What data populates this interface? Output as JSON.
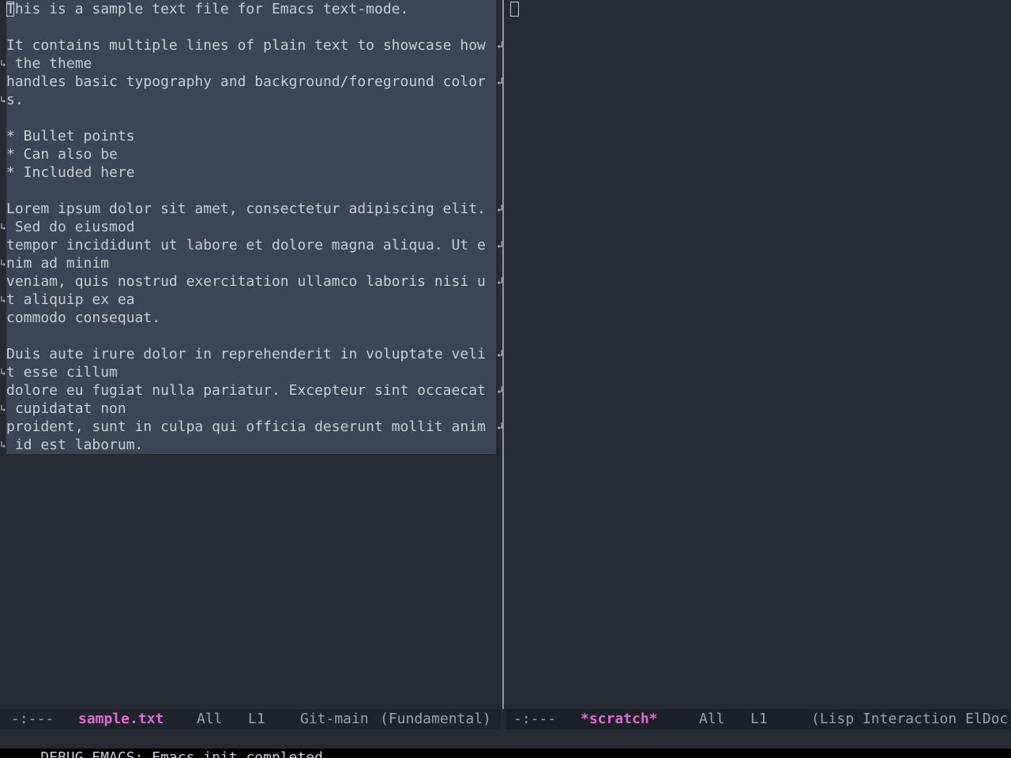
{
  "left_window": {
    "lines": [
      {
        "text": "This is a sample text file for Emacs text-mode."
      },
      {
        "text": ""
      },
      {
        "text": "It contains multiple lines of plain text to showcase how",
        "wrap_right": true
      },
      {
        "text": " the theme",
        "wrap_left": true
      },
      {
        "text": "handles basic typography and background/foreground color",
        "wrap_right": true
      },
      {
        "text": "s.",
        "wrap_left": true
      },
      {
        "text": ""
      },
      {
        "text": "* Bullet points"
      },
      {
        "text": "* Can also be"
      },
      {
        "text": "* Included here"
      },
      {
        "text": ""
      },
      {
        "text": "Lorem ipsum dolor sit amet, consectetur adipiscing elit.",
        "wrap_right": true
      },
      {
        "text": " Sed do eiusmod",
        "wrap_left": true
      },
      {
        "text": "tempor incididunt ut labore et dolore magna aliqua. Ut e",
        "wrap_right": true
      },
      {
        "text": "nim ad minim",
        "wrap_left": true
      },
      {
        "text": "veniam, quis nostrud exercitation ullamco laboris nisi u",
        "wrap_right": true
      },
      {
        "text": "t aliquip ex ea",
        "wrap_left": true
      },
      {
        "text": "commodo consequat."
      },
      {
        "text": ""
      },
      {
        "text": "Duis aute irure dolor in reprehenderit in voluptate veli",
        "wrap_right": true
      },
      {
        "text": "t esse cillum",
        "wrap_left": true
      },
      {
        "text": "dolore eu fugiat nulla pariatur. Excepteur sint occaecat",
        "wrap_right": true
      },
      {
        "text": " cupidatat non",
        "wrap_left": true
      },
      {
        "text": "proident, sunt in culpa qui officia deserunt mollit anim",
        "wrap_right": true
      },
      {
        "text": " id est laborum.",
        "wrap_left": true
      }
    ]
  },
  "left_modeline": {
    "status": "-:---",
    "buffer": "sample.txt",
    "position": "All",
    "line": "L1",
    "vc": "Git-main",
    "mode": "(Fundamental)"
  },
  "right_modeline": {
    "status": "-:---",
    "buffer": "*scratch*",
    "position": "All",
    "line": "L1",
    "mode": "(Lisp Interaction ElDoc)"
  },
  "echo_area": {
    "message": "DEBUG EMACS: Emacs init completed."
  },
  "icons": {
    "wrap_right": "wrap-continuation-right-icon",
    "wrap_left": "wrap-continuation-left-icon"
  },
  "colors": {
    "background": "#252a34",
    "region": "#3b4555",
    "buffer_name": "#e566d8",
    "text": "#c8ccd4"
  }
}
